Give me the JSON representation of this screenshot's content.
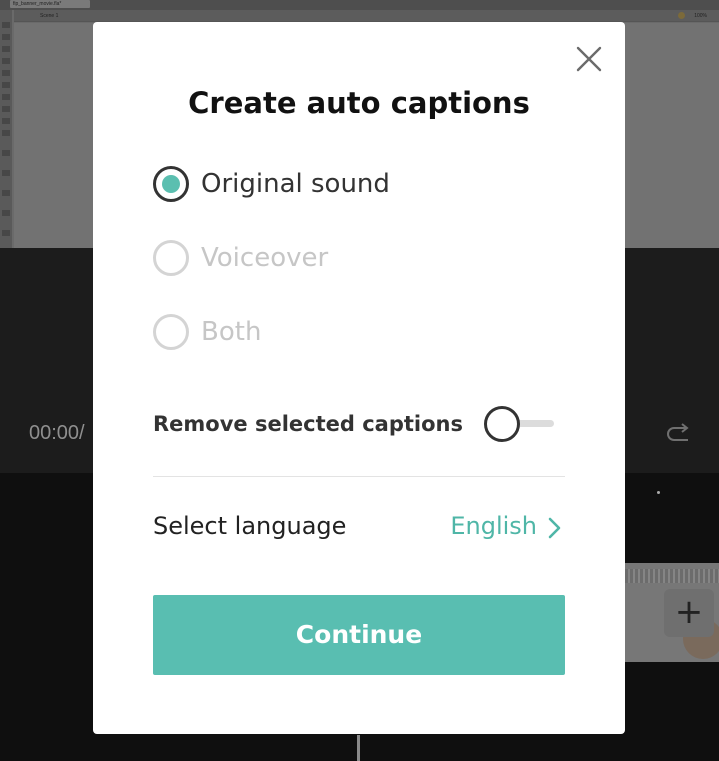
{
  "background": {
    "document_tab": "fip_banner_movie.fla*",
    "scene_label": "Scene 1",
    "zoom": "100%",
    "timecode": "00:00/"
  },
  "dialog": {
    "title": "Create auto captions",
    "close_icon": "close-icon",
    "audio_source": {
      "options": [
        {
          "label": "Original sound",
          "selected": true,
          "enabled": true
        },
        {
          "label": "Voiceover",
          "selected": false,
          "enabled": false
        },
        {
          "label": "Both",
          "selected": false,
          "enabled": false
        }
      ]
    },
    "remove_captions": {
      "label": "Remove selected captions",
      "enabled": false
    },
    "language": {
      "label": "Select language",
      "value": "English",
      "icon": "chevron-right-icon"
    },
    "continue_label": "Continue"
  },
  "colors": {
    "accent": "#59beb1",
    "accent_text": "#4fb6a7",
    "overlay": "#1a1a1a"
  }
}
